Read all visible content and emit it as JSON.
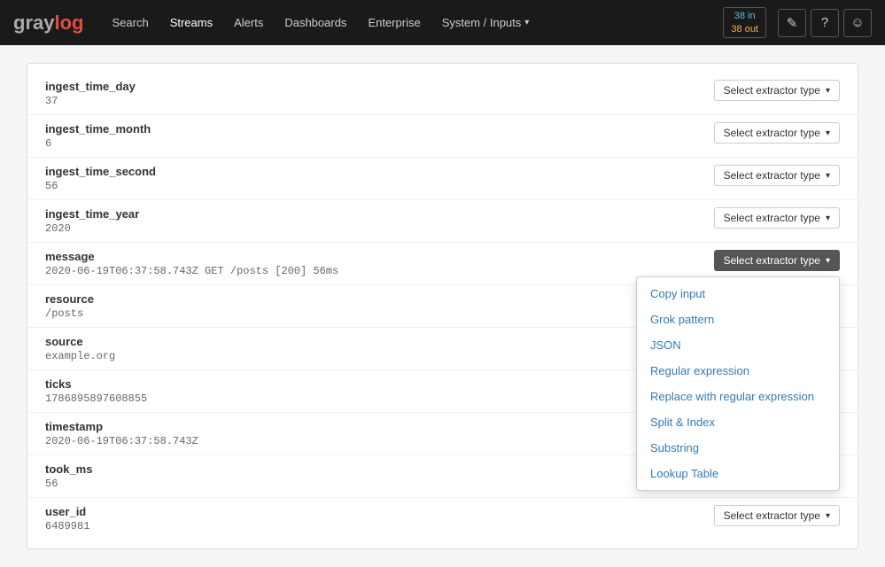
{
  "navbar": {
    "brand": {
      "gray": "gray",
      "log": "log"
    },
    "links": [
      {
        "label": "Search",
        "active": false
      },
      {
        "label": "Streams",
        "active": true
      },
      {
        "label": "Alerts",
        "active": false
      },
      {
        "label": "Dashboards",
        "active": false
      },
      {
        "label": "Enterprise",
        "active": false
      },
      {
        "label": "System / Inputs",
        "active": false,
        "hasArrow": true
      }
    ],
    "counter": {
      "in_count": "38 in",
      "out_count": "38 out"
    },
    "icons": [
      {
        "name": "edit-icon",
        "symbol": "✎"
      },
      {
        "name": "help-icon",
        "symbol": "?"
      },
      {
        "name": "user-icon",
        "symbol": "👤"
      }
    ]
  },
  "fields": [
    {
      "name": "ingest_time_day",
      "value": "37",
      "showDropdown": false,
      "btnActive": false
    },
    {
      "name": "ingest_time_month",
      "value": "6",
      "showDropdown": false,
      "btnActive": false
    },
    {
      "name": "ingest_time_second",
      "value": "56",
      "showDropdown": false,
      "btnActive": false
    },
    {
      "name": "ingest_time_year",
      "value": "2020",
      "showDropdown": false,
      "btnActive": false
    },
    {
      "name": "message",
      "value": "2020-06-19T06:37:58.743Z GET /posts [200] 56ms",
      "showDropdown": true,
      "btnActive": true
    },
    {
      "name": "resource",
      "value": "/posts",
      "showDropdown": false,
      "btnActive": false
    },
    {
      "name": "source",
      "value": "example.org",
      "showDropdown": false,
      "btnActive": false
    },
    {
      "name": "ticks",
      "value": "1786895897608855",
      "showDropdown": false,
      "btnActive": false
    },
    {
      "name": "timestamp",
      "value": "2020-06-19T06:37:58.743Z",
      "showDropdown": false,
      "btnActive": false
    },
    {
      "name": "took_ms",
      "value": "56",
      "showDropdown": false,
      "btnActive": false
    },
    {
      "name": "user_id",
      "value": "6489981",
      "showDropdown": false,
      "btnActive": false
    }
  ],
  "extractor_btn_label": "Select extractor type",
  "dropdown_items": [
    "Copy input",
    "Grok pattern",
    "JSON",
    "Regular expression",
    "Replace with regular expression",
    "Split & Index",
    "Substring",
    "Lookup Table"
  ]
}
